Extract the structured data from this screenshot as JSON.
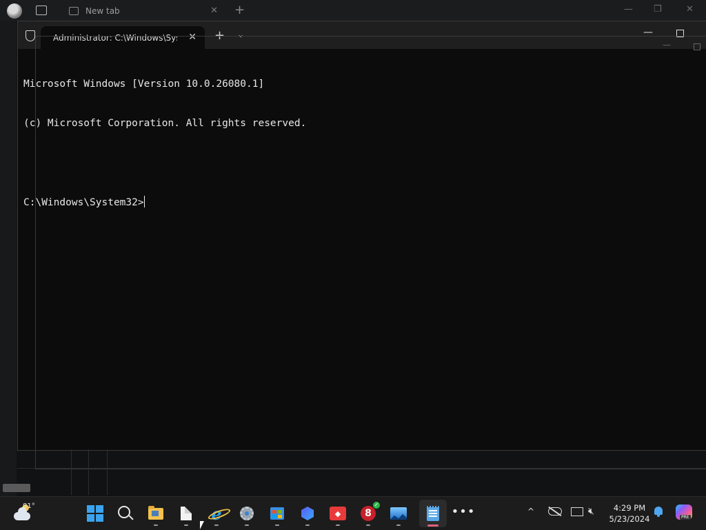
{
  "background_browser": {
    "tab_title": "New tab",
    "new_tab_glyph": "+",
    "close_glyph": "✕",
    "minimize_glyph": "—",
    "restore_glyph": "❐"
  },
  "terminal": {
    "tab_title": "Administrator: C:\\Windows\\Syst",
    "close_glyph": "✕",
    "new_tab_glyph": "+",
    "dropdown_glyph": "⌄",
    "minimize_glyph": "—",
    "console_lines": [
      "Microsoft Windows [Version 10.0.26080.1]",
      "(c) Microsoft Corporation. All rights reserved.",
      "",
      "C:\\Windows\\System32>"
    ]
  },
  "ghost_window": {
    "minimize_glyph": "—"
  },
  "taskbar": {
    "weather": {
      "temperature": "81°",
      "icon": "partly-cloudy-icon"
    },
    "pinned_apps": [
      "start-icon",
      "search-icon",
      "file-explorer-icon",
      "document-icon",
      "internet-explorer-icon",
      "settings-icon",
      "microsoft-store-icon",
      "clipchamp-icon",
      "anydesk-icon",
      "security-app-icon",
      "photos-icon",
      "notepad-icon",
      "more-apps-icon"
    ],
    "more_glyph": "•••",
    "tray": {
      "chevron_glyph": "^",
      "speaker_glyph": "🔇︎"
    },
    "clock": {
      "time": "4:29 PM",
      "date": "5/23/2024"
    },
    "copilot_badge": "PRE"
  },
  "colors": {
    "console_bg": "#0c0c0c",
    "console_text": "#e8e8e8",
    "taskbar_bg": "#1c1c1c",
    "active_indicator": "#e0627a",
    "windows_blue": "#3ba3f0"
  }
}
